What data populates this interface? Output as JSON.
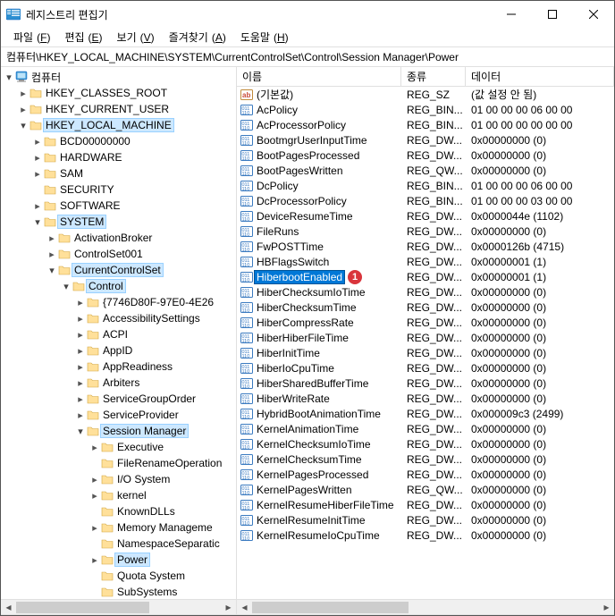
{
  "window": {
    "title": "레지스트리 편집기"
  },
  "menu": {
    "file": "파일",
    "file_u": "F",
    "edit": "편집",
    "edit_u": "E",
    "view": "보기",
    "view_u": "V",
    "fav": "즐겨찾기",
    "fav_u": "A",
    "help": "도움말",
    "help_u": "H"
  },
  "address": "컴퓨터\\HKEY_LOCAL_MACHINE\\SYSTEM\\CurrentControlSet\\Control\\Session Manager\\Power",
  "tree": [
    {
      "d": 0,
      "c": "open",
      "t": "computer",
      "label": "컴퓨터"
    },
    {
      "d": 1,
      "c": "closed",
      "t": "folder",
      "label": "HKEY_CLASSES_ROOT"
    },
    {
      "d": 1,
      "c": "closed",
      "t": "folder",
      "label": "HKEY_CURRENT_USER"
    },
    {
      "d": 1,
      "c": "open",
      "t": "folder",
      "label": "HKEY_LOCAL_MACHINE",
      "sel": true
    },
    {
      "d": 2,
      "c": "closed",
      "t": "folder",
      "label": "BCD00000000"
    },
    {
      "d": 2,
      "c": "closed",
      "t": "folder",
      "label": "HARDWARE"
    },
    {
      "d": 2,
      "c": "closed",
      "t": "folder",
      "label": "SAM"
    },
    {
      "d": 2,
      "c": "none",
      "t": "folder",
      "label": "SECURITY"
    },
    {
      "d": 2,
      "c": "closed",
      "t": "folder",
      "label": "SOFTWARE"
    },
    {
      "d": 2,
      "c": "open",
      "t": "folder",
      "label": "SYSTEM",
      "sel": true
    },
    {
      "d": 3,
      "c": "closed",
      "t": "folder",
      "label": "ActivationBroker"
    },
    {
      "d": 3,
      "c": "closed",
      "t": "folder",
      "label": "ControlSet001"
    },
    {
      "d": 3,
      "c": "open",
      "t": "folder",
      "label": "CurrentControlSet",
      "sel": true
    },
    {
      "d": 4,
      "c": "open",
      "t": "folder",
      "label": "Control",
      "sel": true
    },
    {
      "d": 5,
      "c": "closed",
      "t": "folder",
      "label": "{7746D80F-97E0-4E26"
    },
    {
      "d": 5,
      "c": "closed",
      "t": "folder",
      "label": "AccessibilitySettings"
    },
    {
      "d": 5,
      "c": "closed",
      "t": "folder",
      "label": "ACPI"
    },
    {
      "d": 5,
      "c": "closed",
      "t": "folder",
      "label": "AppID"
    },
    {
      "d": 5,
      "c": "closed",
      "t": "folder",
      "label": "AppReadiness"
    },
    {
      "d": 5,
      "c": "closed",
      "t": "folder",
      "label": "Arbiters"
    },
    {
      "d": 5,
      "c": "closed",
      "t": "folder",
      "label": "ServiceGroupOrder"
    },
    {
      "d": 5,
      "c": "closed",
      "t": "folder",
      "label": "ServiceProvider"
    },
    {
      "d": 5,
      "c": "open",
      "t": "folder",
      "label": "Session Manager",
      "sel": true
    },
    {
      "d": 6,
      "c": "closed",
      "t": "folder",
      "label": "Executive"
    },
    {
      "d": 6,
      "c": "none",
      "t": "folder",
      "label": "FileRenameOperation"
    },
    {
      "d": 6,
      "c": "closed",
      "t": "folder",
      "label": "I/O System"
    },
    {
      "d": 6,
      "c": "closed",
      "t": "folder",
      "label": "kernel"
    },
    {
      "d": 6,
      "c": "none",
      "t": "folder",
      "label": "KnownDLLs"
    },
    {
      "d": 6,
      "c": "closed",
      "t": "folder",
      "label": "Memory Manageme"
    },
    {
      "d": 6,
      "c": "none",
      "t": "folder",
      "label": "NamespaceSeparatic"
    },
    {
      "d": 6,
      "c": "closed",
      "t": "folder",
      "label": "Power",
      "sel": true
    },
    {
      "d": 6,
      "c": "none",
      "t": "folder",
      "label": "Quota System"
    },
    {
      "d": 6,
      "c": "none",
      "t": "folder",
      "label": "SubSystems"
    }
  ],
  "list": {
    "headers": {
      "name": "이름",
      "type": "종류",
      "data": "데이터"
    },
    "rows": [
      {
        "ic": "sz",
        "name": "(기본값)",
        "type": "REG_SZ",
        "data": "(값 설정 안 됨)"
      },
      {
        "ic": "bin",
        "name": "AcPolicy",
        "type": "REG_BIN...",
        "data": "01 00 00 00 06 00 00"
      },
      {
        "ic": "bin",
        "name": "AcProcessorPolicy",
        "type": "REG_BIN...",
        "data": "01 00 00 00 00 00 00"
      },
      {
        "ic": "bin",
        "name": "BootmgrUserInputTime",
        "type": "REG_DW...",
        "data": "0x00000000 (0)"
      },
      {
        "ic": "bin",
        "name": "BootPagesProcessed",
        "type": "REG_DW...",
        "data": "0x00000000 (0)"
      },
      {
        "ic": "bin",
        "name": "BootPagesWritten",
        "type": "REG_QW...",
        "data": "0x00000000 (0)"
      },
      {
        "ic": "bin",
        "name": "DcPolicy",
        "type": "REG_BIN...",
        "data": "01 00 00 00 06 00 00"
      },
      {
        "ic": "bin",
        "name": "DcProcessorPolicy",
        "type": "REG_BIN...",
        "data": "01 00 00 00 03 00 00"
      },
      {
        "ic": "bin",
        "name": "DeviceResumeTime",
        "type": "REG_DW...",
        "data": "0x0000044e (1102)"
      },
      {
        "ic": "bin",
        "name": "FileRuns",
        "type": "REG_DW...",
        "data": "0x00000000 (0)"
      },
      {
        "ic": "bin",
        "name": "FwPOSTTime",
        "type": "REG_DW...",
        "data": "0x0000126b (4715)"
      },
      {
        "ic": "bin",
        "name": "HBFlagsSwitch",
        "type": "REG_DW...",
        "data": "0x00000001 (1)"
      },
      {
        "ic": "bin",
        "name": "HiberbootEnabled",
        "type": "REG_DW...",
        "data": "0x00000001 (1)",
        "selected": true,
        "badge": "1"
      },
      {
        "ic": "bin",
        "name": "HiberChecksumIoTime",
        "type": "REG_DW...",
        "data": "0x00000000 (0)"
      },
      {
        "ic": "bin",
        "name": "HiberChecksumTime",
        "type": "REG_DW...",
        "data": "0x00000000 (0)"
      },
      {
        "ic": "bin",
        "name": "HiberCompressRate",
        "type": "REG_DW...",
        "data": "0x00000000 (0)"
      },
      {
        "ic": "bin",
        "name": "HiberHiberFileTime",
        "type": "REG_DW...",
        "data": "0x00000000 (0)"
      },
      {
        "ic": "bin",
        "name": "HiberInitTime",
        "type": "REG_DW...",
        "data": "0x00000000 (0)"
      },
      {
        "ic": "bin",
        "name": "HiberIoCpuTime",
        "type": "REG_DW...",
        "data": "0x00000000 (0)"
      },
      {
        "ic": "bin",
        "name": "HiberSharedBufferTime",
        "type": "REG_DW...",
        "data": "0x00000000 (0)"
      },
      {
        "ic": "bin",
        "name": "HiberWriteRate",
        "type": "REG_DW...",
        "data": "0x00000000 (0)"
      },
      {
        "ic": "bin",
        "name": "HybridBootAnimationTime",
        "type": "REG_DW...",
        "data": "0x000009c3 (2499)"
      },
      {
        "ic": "bin",
        "name": "KernelAnimationTime",
        "type": "REG_DW...",
        "data": "0x00000000 (0)"
      },
      {
        "ic": "bin",
        "name": "KernelChecksumIoTime",
        "type": "REG_DW...",
        "data": "0x00000000 (0)"
      },
      {
        "ic": "bin",
        "name": "KernelChecksumTime",
        "type": "REG_DW...",
        "data": "0x00000000 (0)"
      },
      {
        "ic": "bin",
        "name": "KernelPagesProcessed",
        "type": "REG_DW...",
        "data": "0x00000000 (0)"
      },
      {
        "ic": "bin",
        "name": "KernelPagesWritten",
        "type": "REG_QW...",
        "data": "0x00000000 (0)"
      },
      {
        "ic": "bin",
        "name": "KernelResumeHiberFileTime",
        "type": "REG_DW...",
        "data": "0x00000000 (0)"
      },
      {
        "ic": "bin",
        "name": "KernelResumeInitTime",
        "type": "REG_DW...",
        "data": "0x00000000 (0)"
      },
      {
        "ic": "bin",
        "name": "KernelResumeIoCpuTime",
        "type": "REG_DW...",
        "data": "0x00000000 (0)"
      }
    ]
  }
}
